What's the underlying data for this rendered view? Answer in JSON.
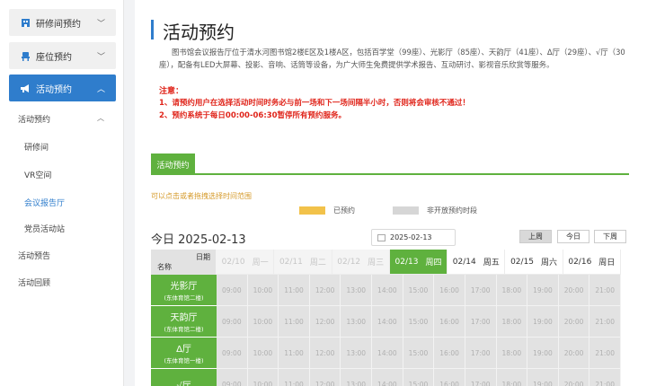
{
  "sidebar": {
    "main_items": [
      {
        "label": "研修间预约",
        "icon": "office-building-icon",
        "expanded": false
      },
      {
        "label": "座位预约",
        "icon": "chair-icon",
        "expanded": false
      },
      {
        "label": "活动预约",
        "icon": "megaphone-icon",
        "expanded": true
      }
    ],
    "group_label": "活动预约",
    "sub_items": [
      "研修间",
      "VR空间",
      "会议报告厅",
      "党员活动站"
    ],
    "selected_sub": "会议报告厅",
    "bottom_items": [
      "活动预告",
      "活动回顾"
    ]
  },
  "page": {
    "title": "活动预约",
    "description": "图书馆会议报告厅位于清水河图书馆2楼E区及1楼A区，包括百学堂（99座）、光影厅（85座）、天韵厅（41座）、Δ厅（29座）、√厅（30座），配备有LED大屏幕、投影、音响、话筒等设备，为广大师生免费提供学术报告、互动研讨、影视音乐欣赏等服务。",
    "notes_label": "注意：",
    "notes": [
      "1、请预约用户在选择活动时间时务必与前一场和下一场间隔半小时，否则将会审核不通过！",
      "2、预约系统于每日00:00-06:30暂停所有预约服务。"
    ]
  },
  "tab": {
    "label": "活动预约"
  },
  "booking": {
    "hint": "可以点击或者拖拽选择时间范围",
    "legend": {
      "booked": "已预约",
      "closed": "非开放预约时段"
    },
    "legend_colors": {
      "booked": "#f2c24a",
      "closed": "#d6d6d6",
      "accent": "#5fb13e"
    },
    "today_text": "今日 2025-02-13",
    "date_value": "2025-02-13",
    "nav": {
      "prev": "上周",
      "today": "今日",
      "next": "下周"
    },
    "corner": {
      "date": "日期",
      "name": "名称"
    },
    "days": [
      {
        "date": "02/10",
        "weekday": "周一",
        "state": "past"
      },
      {
        "date": "02/11",
        "weekday": "周二",
        "state": "past"
      },
      {
        "date": "02/12",
        "weekday": "周三",
        "state": "past"
      },
      {
        "date": "02/13",
        "weekday": "周四",
        "state": "today"
      },
      {
        "date": "02/14",
        "weekday": "周五",
        "state": "future"
      },
      {
        "date": "02/15",
        "weekday": "周六",
        "state": "future"
      },
      {
        "date": "02/16",
        "weekday": "周日",
        "state": "future"
      }
    ],
    "times": [
      "09:00",
      "10:00",
      "11:00",
      "12:00",
      "13:00",
      "14:00",
      "15:00",
      "16:00",
      "17:00",
      "18:00",
      "19:00",
      "20:00",
      "21:00"
    ],
    "rooms": [
      {
        "name": "光影厅",
        "location": "(东体育馆二楼)"
      },
      {
        "name": "天韵厅",
        "location": "(东体育馆二楼)"
      },
      {
        "name": "Δ厅",
        "location": "(东体育馆一楼)"
      },
      {
        "name": "√厅",
        "location": ""
      }
    ]
  }
}
